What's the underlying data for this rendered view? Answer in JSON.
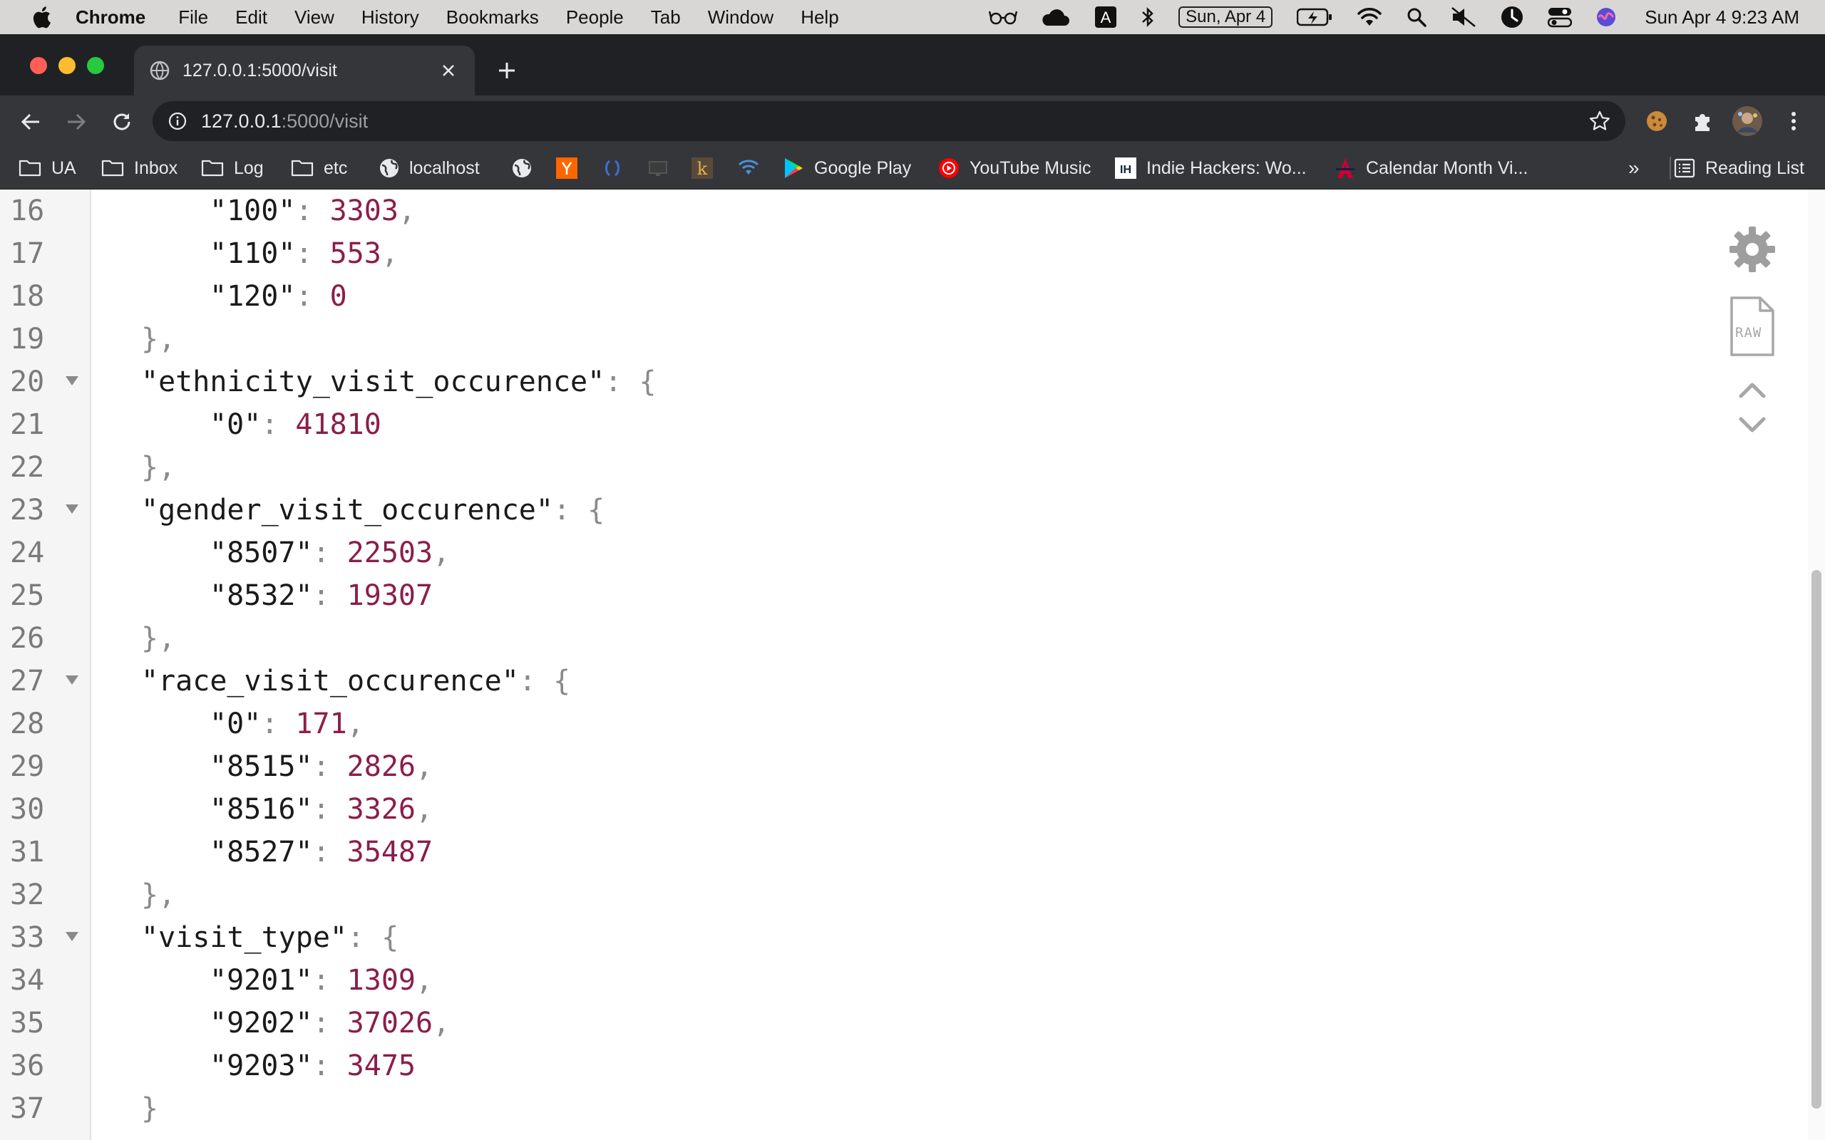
{
  "menubar": {
    "app": "Chrome",
    "items": [
      "File",
      "Edit",
      "View",
      "History",
      "Bookmarks",
      "People",
      "Tab",
      "Window",
      "Help"
    ],
    "date_box": "Sun, Apr 4",
    "clock": "Sun Apr 4  9:23 AM",
    "status_icons": [
      "glasses-icon",
      "cloud-icon",
      "keyboard-a-icon",
      "bluetooth-icon",
      "battery-charging-icon",
      "wifi-icon",
      "spotlight-search-icon",
      "mute-icon",
      "focus-icon",
      "control-center-icon",
      "siri-icon"
    ]
  },
  "browser": {
    "tab": {
      "title": "127.0.0.1:5000/visit"
    },
    "url": {
      "host": "127.0.0.1",
      "path": ":5000/visit"
    },
    "bookmarks": [
      {
        "label": "UA",
        "icon": "folder-icon"
      },
      {
        "label": "Inbox",
        "icon": "folder-icon"
      },
      {
        "label": "Log",
        "icon": "folder-icon"
      },
      {
        "label": "etc",
        "icon": "folder-icon"
      },
      {
        "label": "localhost",
        "icon": "globe-icon"
      },
      {
        "label": "",
        "icon": "globe-icon"
      },
      {
        "label": "",
        "icon": "y-combinator-icon"
      },
      {
        "label": "",
        "icon": "bracket-icon"
      },
      {
        "label": "",
        "icon": "monitor-icon"
      },
      {
        "label": "",
        "icon": "k-icon"
      },
      {
        "label": "",
        "icon": "wireless-icon"
      },
      {
        "label": "Google Play",
        "icon": "google-play-icon"
      },
      {
        "label": "YouTube Music",
        "icon": "youtube-music-icon"
      },
      {
        "label": "Indie Hackers: Wo...",
        "icon": "indie-hackers-icon"
      },
      {
        "label": "Calendar Month Vi...",
        "icon": "arizona-icon"
      }
    ],
    "overflow_label": "»",
    "reading_list_label": "Reading List",
    "colors": {
      "tabstrip": "#202124",
      "toolbar": "#35363a",
      "key": "#1a1a1a",
      "number": "#8b1e4b"
    }
  },
  "viewer": {
    "lines": [
      {
        "n": "16",
        "indent": 2,
        "key": "\"100\"",
        "sep": ": ",
        "value": "3303",
        "tail": ",",
        "fold": false
      },
      {
        "n": "17",
        "indent": 2,
        "key": "\"110\"",
        "sep": ": ",
        "value": "553",
        "tail": ",",
        "fold": false
      },
      {
        "n": "18",
        "indent": 2,
        "key": "\"120\"",
        "sep": ": ",
        "value": "0",
        "tail": "",
        "fold": false
      },
      {
        "n": "19",
        "indent": 1,
        "key": "",
        "sep": "",
        "value": "",
        "tail": "},",
        "fold": false
      },
      {
        "n": "20",
        "indent": 1,
        "key": "\"ethnicity_visit_occurence\"",
        "sep": ": ",
        "value": "",
        "tail": "{",
        "fold": true
      },
      {
        "n": "21",
        "indent": 2,
        "key": "\"0\"",
        "sep": ": ",
        "value": "41810",
        "tail": "",
        "fold": false
      },
      {
        "n": "22",
        "indent": 1,
        "key": "",
        "sep": "",
        "value": "",
        "tail": "},",
        "fold": false
      },
      {
        "n": "23",
        "indent": 1,
        "key": "\"gender_visit_occurence\"",
        "sep": ": ",
        "value": "",
        "tail": "{",
        "fold": true
      },
      {
        "n": "24",
        "indent": 2,
        "key": "\"8507\"",
        "sep": ": ",
        "value": "22503",
        "tail": ",",
        "fold": false
      },
      {
        "n": "25",
        "indent": 2,
        "key": "\"8532\"",
        "sep": ": ",
        "value": "19307",
        "tail": "",
        "fold": false
      },
      {
        "n": "26",
        "indent": 1,
        "key": "",
        "sep": "",
        "value": "",
        "tail": "},",
        "fold": false
      },
      {
        "n": "27",
        "indent": 1,
        "key": "\"race_visit_occurence\"",
        "sep": ": ",
        "value": "",
        "tail": "{",
        "fold": true
      },
      {
        "n": "28",
        "indent": 2,
        "key": "\"0\"",
        "sep": ": ",
        "value": "171",
        "tail": ",",
        "fold": false
      },
      {
        "n": "29",
        "indent": 2,
        "key": "\"8515\"",
        "sep": ": ",
        "value": "2826",
        "tail": ",",
        "fold": false
      },
      {
        "n": "30",
        "indent": 2,
        "key": "\"8516\"",
        "sep": ": ",
        "value": "3326",
        "tail": ",",
        "fold": false
      },
      {
        "n": "31",
        "indent": 2,
        "key": "\"8527\"",
        "sep": ": ",
        "value": "35487",
        "tail": "",
        "fold": false
      },
      {
        "n": "32",
        "indent": 1,
        "key": "",
        "sep": "",
        "value": "",
        "tail": "},",
        "fold": false
      },
      {
        "n": "33",
        "indent": 1,
        "key": "\"visit_type\"",
        "sep": ": ",
        "value": "",
        "tail": "{",
        "fold": true
      },
      {
        "n": "34",
        "indent": 2,
        "key": "\"9201\"",
        "sep": ": ",
        "value": "1309",
        "tail": ",",
        "fold": false
      },
      {
        "n": "35",
        "indent": 2,
        "key": "\"9202\"",
        "sep": ": ",
        "value": "37026",
        "tail": ",",
        "fold": false
      },
      {
        "n": "36",
        "indent": 2,
        "key": "\"9203\"",
        "sep": ": ",
        "value": "3475",
        "tail": "",
        "fold": false
      },
      {
        "n": "37",
        "indent": 1,
        "key": "",
        "sep": "",
        "value": "",
        "tail": "}",
        "fold": false
      }
    ],
    "tools": {
      "settings_icon": "gear-icon",
      "raw_icon": "raw-file-icon",
      "raw_label": "RAW",
      "up_icon": "chevron-up-icon",
      "down_icon": "chevron-down-icon"
    }
  }
}
